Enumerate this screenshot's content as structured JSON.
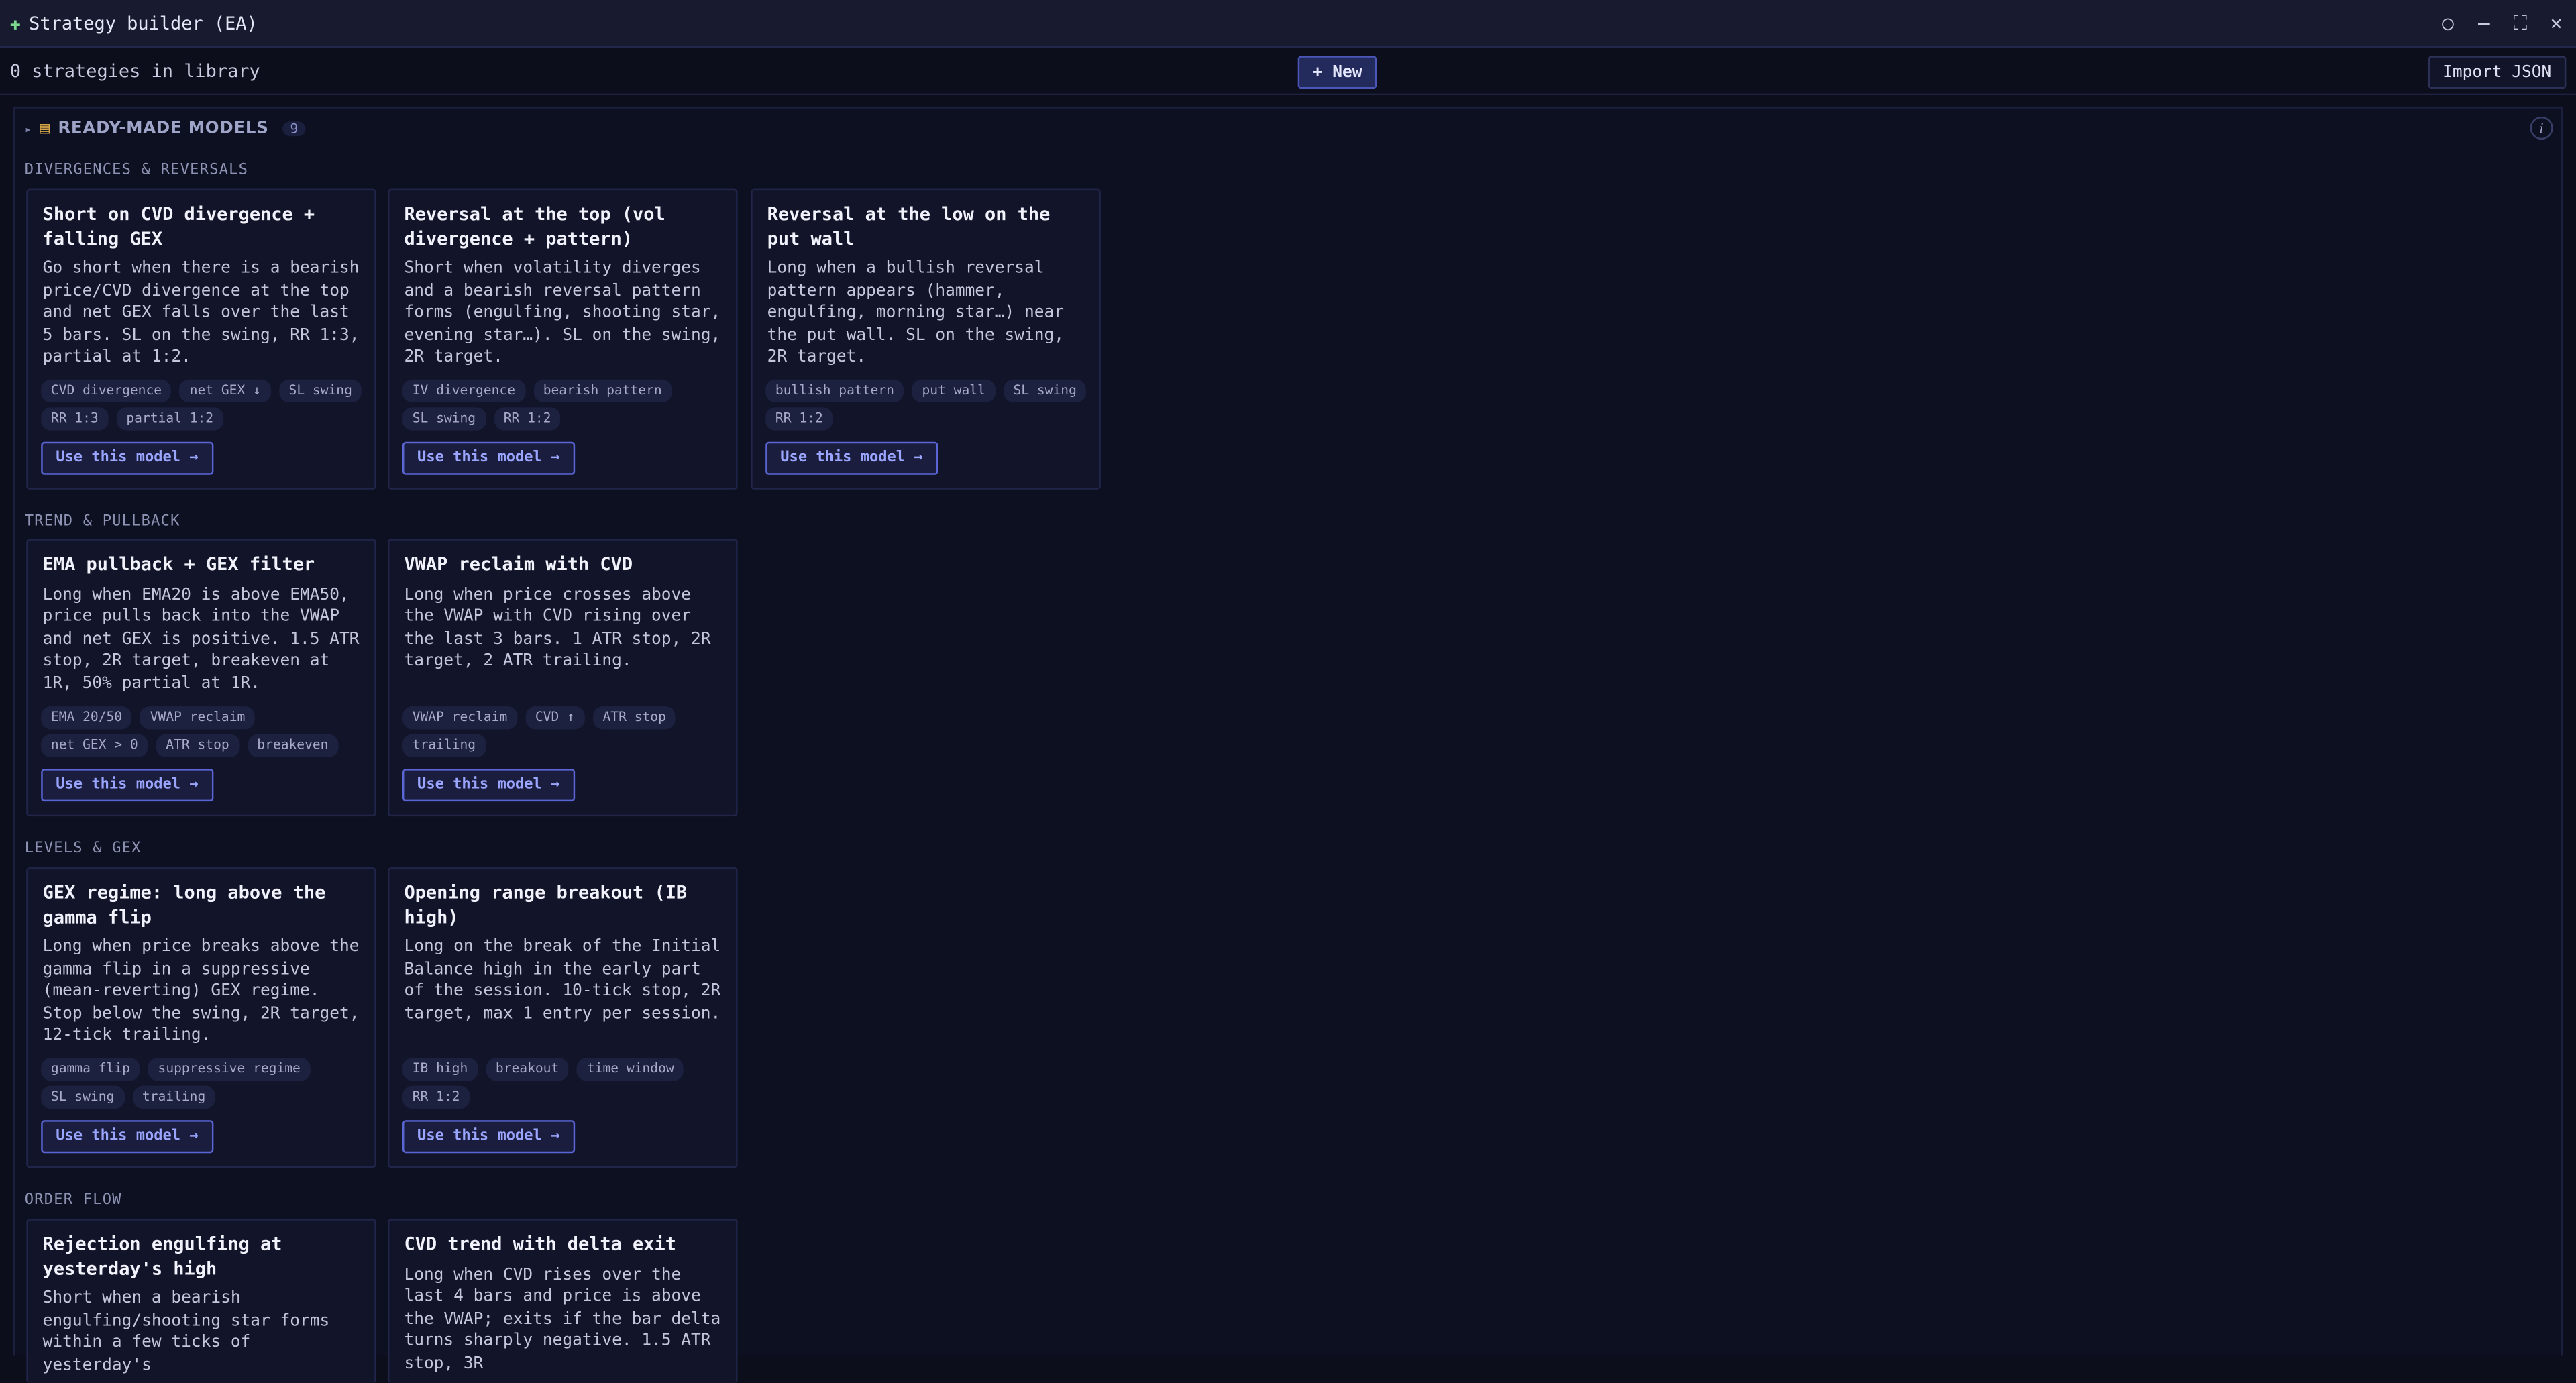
{
  "window": {
    "title": "Strategy builder (EA)",
    "app_icon": "puzzle-icon",
    "controls": [
      "circle-icon",
      "minimize-icon",
      "maximize-icon",
      "close-icon"
    ]
  },
  "toolbar": {
    "count_text": "0 strategies in library",
    "new_label": "+ New",
    "import_label": "Import JSON"
  },
  "panel": {
    "title": "READY-MADE MODELS",
    "badge": "9",
    "icon": "books-icon",
    "info_icon": "info-icon"
  },
  "sections": [
    {
      "title": "DIVERGENCES & REVERSALS",
      "cards": [
        {
          "title": "Short on CVD divergence + falling GEX",
          "desc": "Go short when there is a bearish price/CVD divergence at the top and net GEX falls over the last 5 bars. SL on the swing, RR 1:3, partial at 1:2.",
          "tags": [
            "CVD divergence",
            "net GEX ↓",
            "SL swing",
            "RR 1:3",
            "partial 1:2"
          ],
          "button": "Use this model →"
        },
        {
          "title": "Reversal at the top (vol divergence + pattern)",
          "desc": "Short when volatility diverges and a bearish reversal pattern forms (engulfing, shooting star, evening star…). SL on the swing, 2R target.",
          "tags": [
            "IV divergence",
            "bearish pattern",
            "SL swing",
            "RR 1:2"
          ],
          "button": "Use this model →"
        },
        {
          "title": "Reversal at the low on the put wall",
          "desc": "Long when a bullish reversal pattern appears (hammer, engulfing, morning star…) near the put wall. SL on the swing, 2R target.",
          "tags": [
            "bullish pattern",
            "put wall",
            "SL swing",
            "RR 1:2"
          ],
          "button": "Use this model →"
        }
      ]
    },
    {
      "title": "TREND & PULLBACK",
      "cards": [
        {
          "title": "EMA pullback + GEX filter",
          "desc": "Long when EMA20 is above EMA50, price pulls back into the VWAP and net GEX is positive. 1.5 ATR stop, 2R target, breakeven at 1R, 50% partial at 1R.",
          "tags": [
            "EMA 20/50",
            "VWAP reclaim",
            "net GEX > 0",
            "ATR stop",
            "breakeven"
          ],
          "button": "Use this model →"
        },
        {
          "title": "VWAP reclaim with CVD",
          "desc": "Long when price crosses above the VWAP with CVD rising over the last 3 bars. 1 ATR stop, 2R target, 2 ATR trailing.",
          "tags": [
            "VWAP reclaim",
            "CVD ↑",
            "ATR stop",
            "trailing"
          ],
          "button": "Use this model →"
        }
      ]
    },
    {
      "title": "LEVELS & GEX",
      "cards": [
        {
          "title": "GEX regime: long above the gamma flip",
          "desc": "Long when price breaks above the gamma flip in a suppressive (mean-reverting) GEX regime. Stop below the swing, 2R target, 12-tick trailing.",
          "tags": [
            "gamma flip",
            "suppressive regime",
            "SL swing",
            "trailing"
          ],
          "button": "Use this model →"
        },
        {
          "title": "Opening range breakout (IB high)",
          "desc": "Long on the break of the Initial Balance high in the early part of the session. 10-tick stop, 2R target, max 1 entry per session.",
          "tags": [
            "IB high",
            "breakout",
            "time window",
            "RR 1:2"
          ],
          "button": "Use this model →"
        }
      ]
    },
    {
      "title": "ORDER FLOW",
      "cards": [
        {
          "title": "Rejection engulfing at yesterday's high",
          "desc": "Short when a bearish engulfing/shooting star forms within a few ticks of yesterday's",
          "tags": [],
          "button": ""
        },
        {
          "title": "CVD trend with delta exit",
          "desc": "Long when CVD rises over the last 4 bars and price is above the VWAP; exits if the bar delta turns sharply negative. 1.5 ATR stop, 3R",
          "tags": [],
          "button": ""
        }
      ]
    }
  ]
}
